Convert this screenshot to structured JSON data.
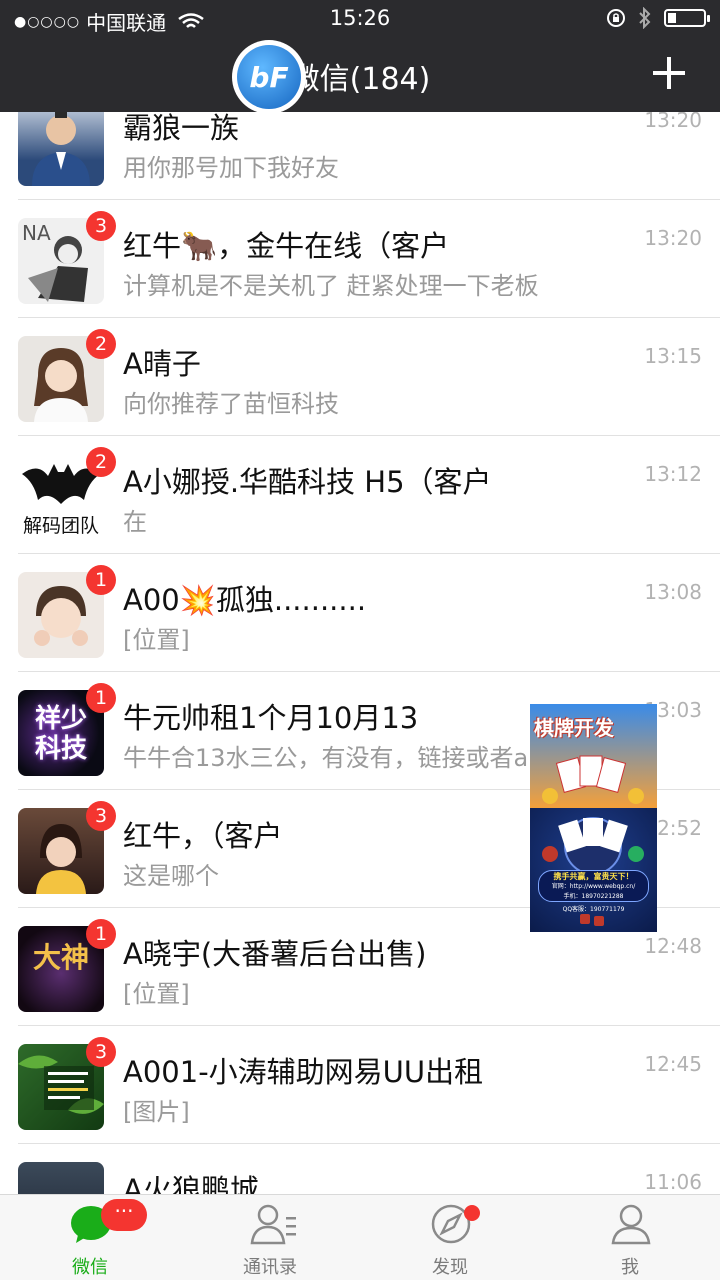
{
  "status_bar": {
    "carrier": "中国联通",
    "dots": "●○○○○",
    "time": "15:26"
  },
  "header": {
    "title": "微信(184)",
    "logo_text": "bF"
  },
  "chats": [
    {
      "name": "霸狼一族",
      "message": "用你那号加下我好友",
      "time": "13:20",
      "badge": ""
    },
    {
      "name": "红牛🐂，金牛在线（客户",
      "message": "计算机是不是关机了 赶紧处理一下老板",
      "time": "13:20",
      "badge": "3"
    },
    {
      "name": "A晴子",
      "message": "向你推荐了苗恒科技",
      "time": "13:15",
      "badge": "2"
    },
    {
      "name": "A小娜授.华酷科技 H5（客户",
      "message": "在",
      "time": "13:12",
      "badge": "2"
    },
    {
      "name": "A00💥孤独..........",
      "message": "[位置]",
      "time": "13:08",
      "badge": "1"
    },
    {
      "name": "牛元帅租1个月10月13",
      "message": "牛牛合13水三公，有没有，链接或者a",
      "time": "13:03",
      "badge": "1"
    },
    {
      "name": "红牛，（客户",
      "message": "这是哪个",
      "time": "12:52",
      "badge": "3"
    },
    {
      "name": "A晓宇(大番薯后台出售)",
      "message": "[位置]",
      "time": "12:48",
      "badge": "1"
    },
    {
      "name": "A001-小涛辅助网易UU出租",
      "message": "[图片]",
      "time": "12:45",
      "badge": "3"
    },
    {
      "name": "A火狼鹏城",
      "message": "",
      "time": "11:06",
      "badge": ""
    }
  ],
  "avatar_texts": {
    "chat3": "解码团队",
    "chat5": "祥少科技",
    "chat7": "大神"
  },
  "ad": {
    "top_text": "棋牌开发",
    "caption_line1": "携手共赢，富贵天下！",
    "caption_line2": "官网：http://www.webqp.cn/",
    "caption_line3": "手机：18970221288",
    "caption_line4": "QQ客服：190771179"
  },
  "tabbar": {
    "tabs": [
      {
        "label": "微信",
        "icon": "chat-bubble-icon"
      },
      {
        "label": "通讯录",
        "icon": "contacts-icon"
      },
      {
        "label": "发现",
        "icon": "compass-icon"
      },
      {
        "label": "我",
        "icon": "person-icon"
      }
    ],
    "chat_badge": "···"
  },
  "colors": {
    "header_bg": "#2b2b2e",
    "badge_red": "#f43530",
    "active_green": "#1aad19"
  }
}
